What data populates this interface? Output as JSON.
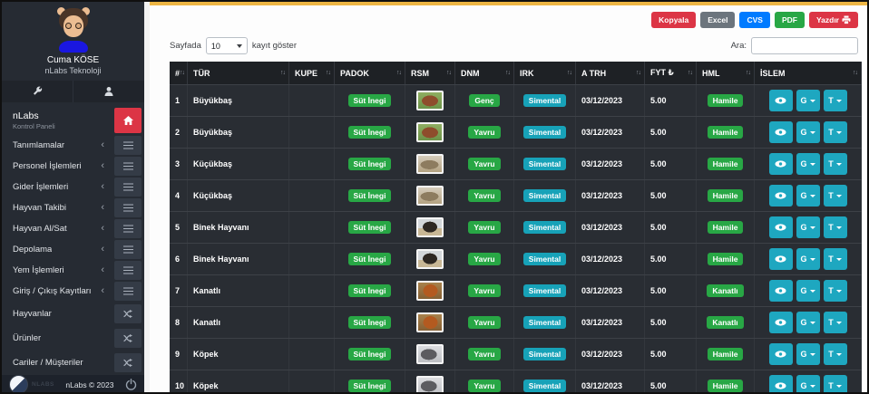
{
  "colors": {
    "accent_bar": "#eeb644",
    "badge_green": "#28a745",
    "badge_cyan": "#17a2b8",
    "action_button": "#1ea7c0",
    "danger": "#dc3545",
    "sidebar_bg": "#262b33",
    "table_header_bg": "#1e2125",
    "table_row_bg": "#292d33"
  },
  "sidebar": {
    "user": {
      "name": "Cuma KÖSE",
      "org": "nLabs Teknoloji"
    },
    "brand": {
      "title": "nLabs",
      "subtitle": "Kontrol Paneli"
    },
    "menu": [
      {
        "label": "Tanımlamalar"
      },
      {
        "label": "Personel İşlemleri"
      },
      {
        "label": "Gider İşlemleri"
      },
      {
        "label": "Hayvan Takibi"
      },
      {
        "label": "Hayvan Al/Sat"
      },
      {
        "label": "Depolama"
      },
      {
        "label": "Yem İşlemleri"
      },
      {
        "label": "Giriş / Çıkış Kayıtları"
      }
    ],
    "links": [
      {
        "label": "Hayvanlar"
      },
      {
        "label": "Ürünler"
      },
      {
        "label": "Cariler / Müşteriler"
      }
    ],
    "footer": {
      "logo_text": "NLABS",
      "copyright": "nLabs © 2023"
    }
  },
  "icons": {
    "sort": "↑↓",
    "chevron_left": "‹"
  },
  "toolbar": {
    "buttons": [
      {
        "label": "Kopyala",
        "color": "#dc3545",
        "icon": ""
      },
      {
        "label": "Excel",
        "color": "#6c757d",
        "icon": ""
      },
      {
        "label": "CVS",
        "color": "#007bff",
        "icon": ""
      },
      {
        "label": "PDF",
        "color": "#28a745",
        "icon": ""
      },
      {
        "label": "Yazdır",
        "color": "#dc3545",
        "icon": "printer"
      }
    ]
  },
  "page_size": {
    "prefix": "Sayfada",
    "value": "10",
    "suffix": "kayıt göster"
  },
  "search": {
    "label": "Ara:",
    "value": ""
  },
  "table": {
    "headers": [
      "#",
      "TÜR",
      "KUPE",
      "PADOK",
      "RSM",
      "DNM",
      "IRK",
      "A TRH",
      "FYT ₺",
      "HML",
      "İSLEM"
    ],
    "action_labels": {
      "view": "eye",
      "g": "G",
      "t": "T"
    },
    "rows": [
      {
        "num": "1",
        "tur": "Büyükbaş",
        "kupe": "",
        "padok": "Süt İnegi",
        "rsm": "cow",
        "dnm": "Genç",
        "irk": "Simental",
        "atrh": "03/12/2023",
        "fyt": "5.00",
        "hml": "Hamile"
      },
      {
        "num": "2",
        "tur": "Büyükbaş",
        "kupe": "",
        "padok": "Süt İnegi",
        "rsm": "cow",
        "dnm": "Yavru",
        "irk": "Simental",
        "atrh": "03/12/2023",
        "fyt": "5.00",
        "hml": "Hamile"
      },
      {
        "num": "3",
        "tur": "Küçükbaş",
        "kupe": "",
        "padok": "Süt İnegi",
        "rsm": "sheep",
        "dnm": "Yavru",
        "irk": "Simental",
        "atrh": "03/12/2023",
        "fyt": "5.00",
        "hml": "Hamile"
      },
      {
        "num": "4",
        "tur": "Küçükbaş",
        "kupe": "",
        "padok": "Süt İnegi",
        "rsm": "sheep",
        "dnm": "Yavru",
        "irk": "Simental",
        "atrh": "03/12/2023",
        "fyt": "5.00",
        "hml": "Hamile"
      },
      {
        "num": "5",
        "tur": "Binek Hayvanı",
        "kupe": "",
        "padok": "Süt İnegi",
        "rsm": "horse",
        "dnm": "Yavru",
        "irk": "Simental",
        "atrh": "03/12/2023",
        "fyt": "5.00",
        "hml": "Hamile"
      },
      {
        "num": "6",
        "tur": "Binek Hayvanı",
        "kupe": "",
        "padok": "Süt İnegi",
        "rsm": "horse",
        "dnm": "Yavru",
        "irk": "Simental",
        "atrh": "03/12/2023",
        "fyt": "5.00",
        "hml": "Hamile"
      },
      {
        "num": "7",
        "tur": "Kanatlı",
        "kupe": "",
        "padok": "Süt İnegi",
        "rsm": "chicken",
        "dnm": "Yavru",
        "irk": "Simental",
        "atrh": "03/12/2023",
        "fyt": "5.00",
        "hml": "Kanatlı"
      },
      {
        "num": "8",
        "tur": "Kanatlı",
        "kupe": "",
        "padok": "Süt İnegi",
        "rsm": "chicken",
        "dnm": "Yavru",
        "irk": "Simental",
        "atrh": "03/12/2023",
        "fyt": "5.00",
        "hml": "Kanatlı"
      },
      {
        "num": "9",
        "tur": "Köpek",
        "kupe": "",
        "padok": "Süt İnegi",
        "rsm": "dog",
        "dnm": "Yavru",
        "irk": "Simental",
        "atrh": "03/12/2023",
        "fyt": "5.00",
        "hml": "Hamile"
      },
      {
        "num": "10",
        "tur": "Köpek",
        "kupe": "",
        "padok": "Süt İnegi",
        "rsm": "dog",
        "dnm": "Yavru",
        "irk": "Simental",
        "atrh": "03/12/2023",
        "fyt": "5.00",
        "hml": "Hamile"
      }
    ]
  }
}
